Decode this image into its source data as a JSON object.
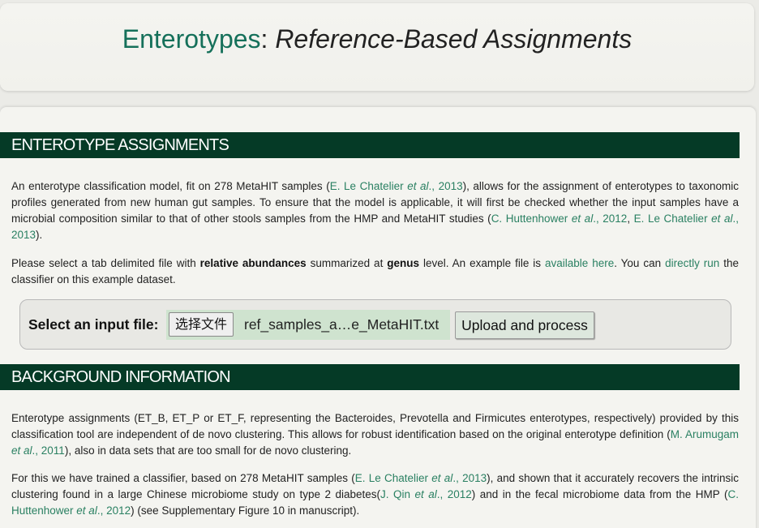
{
  "header": {
    "brand": "Enterotypes",
    "separator": ": ",
    "subtitle": "Reference-Based Assignments"
  },
  "section1": {
    "title": "ENTEROTYPE ASSIGNMENTS",
    "p1": {
      "t1": "An enterotype classification model, fit on 278 MetaHIT samples (",
      "ref1": {
        "author": "E. Le Chatelier ",
        "etal": "et al",
        "year": "., 2013"
      },
      "t2": "), allows for the assignment of enterotypes to taxonomic profiles generated from new human gut samples. To ensure that the model is applicable, it will first be checked whether the input samples have a microbial composition similar to that of other stools samples from the HMP and MetaHIT studies (",
      "ref2": {
        "author": "C. Huttenhower ",
        "etal": "et al",
        "year": "., 2012"
      },
      "t3": ", ",
      "ref3": {
        "author": "E. Le Chatelier ",
        "etal": "et al",
        "year": "., 2013"
      },
      "t4": ")."
    },
    "p2": {
      "t1": "Please select a tab delimited file with ",
      "b1": "relative abundances",
      "t2": " summarized at ",
      "b2": "genus",
      "t3": " level. An example file is ",
      "link1": "available here",
      "t4": ". You can ",
      "link2": "directly run",
      "t5": " the classifier on this example dataset."
    },
    "upload": {
      "label": "Select an input file:",
      "choose_button": "选择文件",
      "file_name": "ref_samples_a…e_MetaHIT.txt",
      "submit_button": "Upload and process"
    }
  },
  "section2": {
    "title": "BACKGROUND INFORMATION",
    "p1": {
      "t1": "Enterotype assignments (ET_B, ET_P or ET_F, representing the Bacteroides, Prevotella and Firmicutes enterotypes, respectively) provided by this classification tool are independent of de novo clustering. This allows for robust identification based on the original enterotype definition (",
      "ref1": {
        "author": "M. Arumugam ",
        "etal": "et al",
        "year": "., 2011"
      },
      "t2": "), also in data sets that are too small for de novo clustering."
    },
    "p2": {
      "t1": "For this we have trained a classifier, based on 278 MetaHIT samples (",
      "ref1": {
        "author": "E. Le Chatelier ",
        "etal": "et al",
        "year": "., 2013"
      },
      "t2": "), and shown that it accurately recovers the intrinsic clustering found in a large Chinese microbiome study on type 2 diabetes(",
      "ref2": {
        "author": "J. Qin ",
        "etal": "et al",
        "year": "., 2012"
      },
      "t3": ") and in the fecal microbiome data from the HMP (",
      "ref3": {
        "author": "C. Huttenhower ",
        "etal": "et al",
        "year": "., 2012"
      },
      "t4": ") (see Supplementary Figure 10 in manuscript)."
    }
  },
  "colors": {
    "brand": "#15705a",
    "section_bar": "#053a26",
    "link": "#2a8062",
    "file_area": "#cfe3cf"
  }
}
